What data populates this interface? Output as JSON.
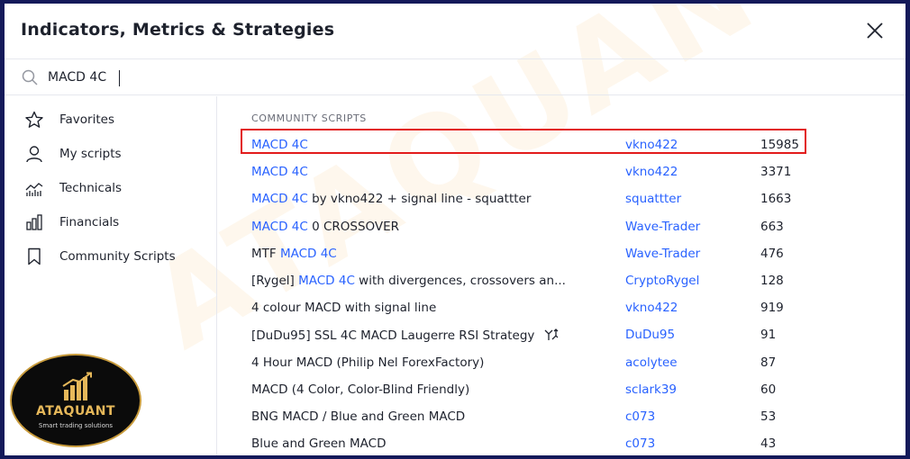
{
  "dialog": {
    "title": "Indicators, Metrics & Strategies"
  },
  "search": {
    "value": "MACD 4C"
  },
  "sidebar": {
    "items": [
      {
        "label": "Favorites",
        "icon": "star-icon"
      },
      {
        "label": "My scripts",
        "icon": "user-icon"
      },
      {
        "label": "Technicals",
        "icon": "chart-icon"
      },
      {
        "label": "Financials",
        "icon": "bar-chart-icon"
      },
      {
        "label": "Community Scripts",
        "icon": "bookmark-icon"
      }
    ]
  },
  "main": {
    "section_title": "COMMUNITY SCRIPTS",
    "rows": [
      {
        "pre": "",
        "hl": "MACD 4C",
        "post": "",
        "author": "vkno422",
        "count": "15985"
      },
      {
        "pre": "",
        "hl": "MACD 4C",
        "post": "",
        "author": "vkno422",
        "count": "3371"
      },
      {
        "pre": "",
        "hl": "MACD 4C",
        "post": " by vkno422 + signal line - squattter",
        "author": "squattter",
        "count": "1663"
      },
      {
        "pre": "",
        "hl": "MACD 4C",
        "post": " 0 CROSSOVER",
        "author": "Wave-Trader",
        "count": "663"
      },
      {
        "pre": "MTF ",
        "hl": "MACD 4C",
        "post": "",
        "author": "Wave-Trader",
        "count": "476"
      },
      {
        "pre": "[Rygel] ",
        "hl": "MACD 4C",
        "post": " with divergences, crossovers an...",
        "author": "CryptoRygel",
        "count": "128"
      },
      {
        "pre": "4 colour MACD with signal line",
        "hl": "",
        "post": "",
        "author": "vkno422",
        "count": "919"
      },
      {
        "pre": "[DuDu95] SSL 4C MACD Laugerre RSI Strategy",
        "hl": "",
        "post": "",
        "author": "DuDu95",
        "count": "91",
        "strategy": true
      },
      {
        "pre": "4 Hour MACD (Philip Nel ForexFactory)",
        "hl": "",
        "post": "",
        "author": "acolytee",
        "count": "87"
      },
      {
        "pre": "MACD (4 Color, Color-Blind Friendly)",
        "hl": "",
        "post": "",
        "author": "sclark39",
        "count": "60"
      },
      {
        "pre": "BNG MACD / Blue and Green MACD",
        "hl": "",
        "post": "",
        "author": "c073",
        "count": "53"
      },
      {
        "pre": "Blue and Green MACD",
        "hl": "",
        "post": "",
        "author": "c073",
        "count": "43"
      }
    ]
  },
  "watermark": "ATAQUANT",
  "logo": {
    "name": "ATAQUANT",
    "tagline": "Smart trading solutions"
  },
  "colors": {
    "frame": "#141a5a",
    "link": "#2962ff",
    "highlight_box": "#e21b1b",
    "logo_gold": "#e6b85a"
  }
}
